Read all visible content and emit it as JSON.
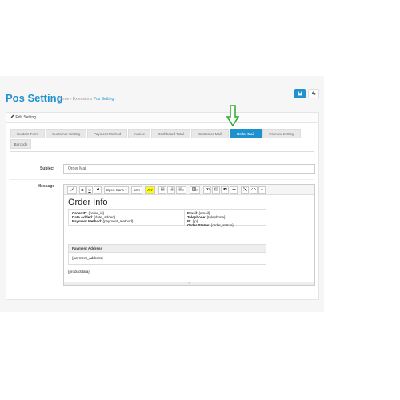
{
  "header": {
    "title": "Pos Setting",
    "breadcrumb": [
      "Home",
      "Extensions",
      "Pos Setting"
    ],
    "breadcrumb_sep": "›"
  },
  "panel": {
    "heading": "Edit Setting"
  },
  "tabs": [
    "Custom Form",
    "Customer Setting",
    "Payment Method",
    "Invoice",
    "Dashboard Total",
    "Customer Mail",
    "Order Mail",
    "Paynow Setting",
    "Barcode"
  ],
  "active_tab": "Order Mail",
  "form": {
    "subject_label": "Subject",
    "subject_value": "Order Mail",
    "message_label": "Message"
  },
  "toolbar": {
    "font": "Open Sans",
    "size": "13",
    "bold": "B",
    "underline": "U",
    "help": "?"
  },
  "message": {
    "heading": "Order Info",
    "left": [
      {
        "label": "Order ID",
        "value": "{order_id}"
      },
      {
        "label": "Date Added",
        "value": "{date_added}"
      },
      {
        "label": "Payment Method",
        "value": "{payment_method}"
      }
    ],
    "right": [
      {
        "label": "Email",
        "value": "{email}"
      },
      {
        "label": "Telephone",
        "value": "{telephone}"
      },
      {
        "label": "IP",
        "value": "{ip}"
      },
      {
        "label": "Order Status",
        "value": "{order_status}"
      }
    ],
    "address_heading": "Payment Address",
    "address_value": "{payment_address}",
    "products": "{productdata}"
  },
  "colors": {
    "accent": "#1e91cf",
    "arrow": "#2ea82e"
  }
}
